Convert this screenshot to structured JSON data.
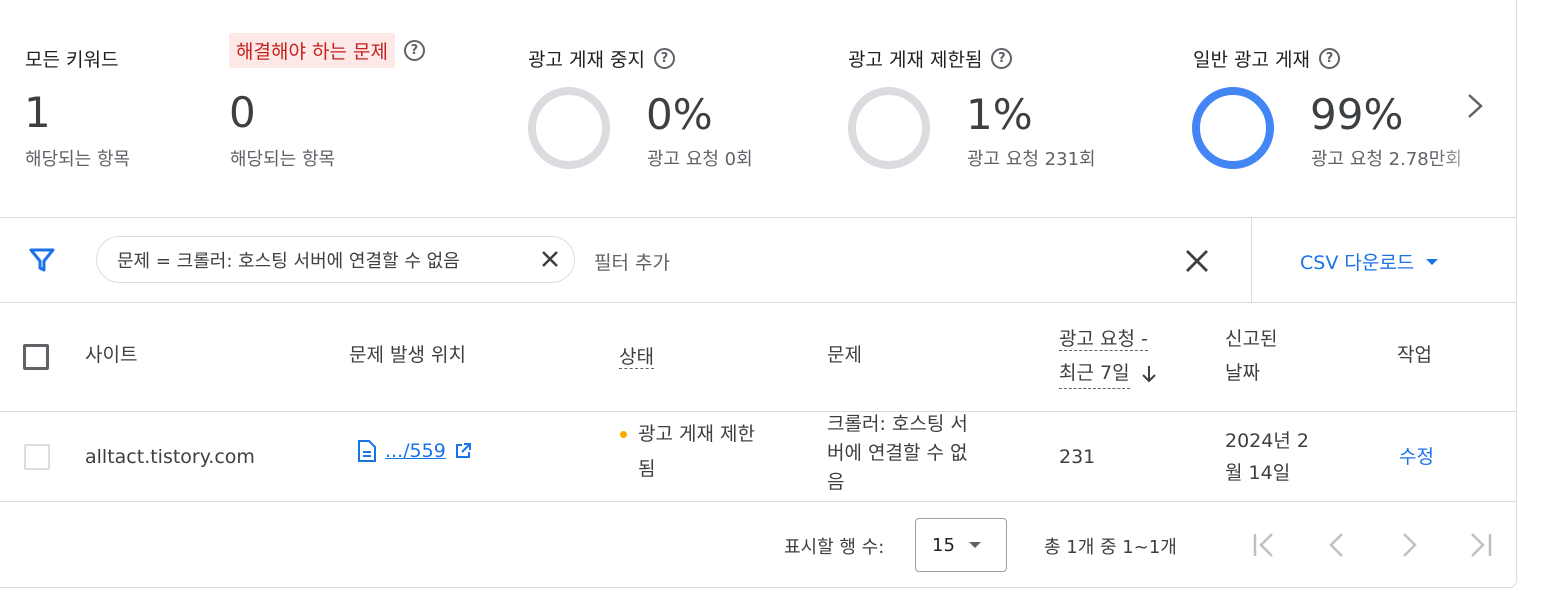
{
  "summary": {
    "all_keywords": {
      "label": "모든 키워드",
      "value": "1",
      "sub": "해당되는 항목"
    },
    "issues": {
      "label": "해결해야 하는 문제",
      "value": "0",
      "sub": "해당되는 항목"
    },
    "stopped": {
      "label": "광고 게재 중지",
      "percent": "0%",
      "sub": "광고 요청 0회",
      "fraction": 0
    },
    "limited": {
      "label": "광고 게재 제한됨",
      "percent": "1%",
      "sub": "광고 요청 231회",
      "fraction": 0.01
    },
    "normal": {
      "label": "일반 광고 게재",
      "percent": "99%",
      "sub": "광고 요청 2.78만회",
      "fraction": 0.99
    },
    "help_glyph": "?"
  },
  "filter": {
    "chip_text": "문제 = 크롤러: 호스팅 서버에 연결할 수 없음",
    "add_filter": "필터 추가",
    "csv_label": "CSV 다운로드"
  },
  "table": {
    "headers": {
      "site": "사이트",
      "location": "문제 발생 위치",
      "status": "상태",
      "issue": "문제",
      "requests_line1": "광고 요청 -",
      "requests_line2": "최근 7일",
      "reported_line1": "신고된",
      "reported_line2": "날짜",
      "action": "작업"
    },
    "rows": [
      {
        "site": "alltact.tistory.com",
        "location": ".../559",
        "status_line1": "광고 게재 제한",
        "status_line2": "됨",
        "issue_line1": "크롤러: 호스팅 서",
        "issue_line2": "버에 연결할 수 없",
        "issue_line3": "음",
        "requests": "231",
        "date_line1": "2024년 2",
        "date_line2": "월 14일",
        "action": "수정"
      }
    ]
  },
  "pagination": {
    "rows_label": "표시할 행 수:",
    "rows_value": "15",
    "range": "총 1개 중 1~1개"
  },
  "colors": {
    "accent": "#1a73e8",
    "ring_blue": "#4285f4",
    "ring_grey": "#dadce0",
    "issue_chip_bg": "#fce8e6",
    "issue_chip_text": "#c5221f",
    "status_dot": "#f9ab00"
  }
}
